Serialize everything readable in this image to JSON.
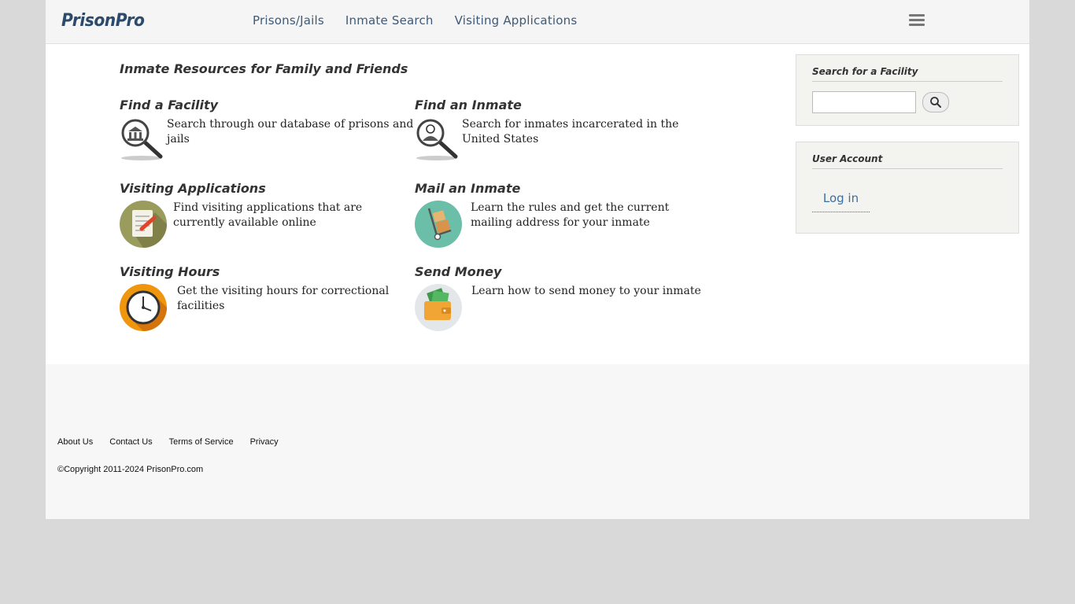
{
  "header": {
    "logo": "PrisonPro",
    "nav": [
      "Prisons/Jails",
      "Inmate Search",
      "Visiting Applications"
    ]
  },
  "main": {
    "title": "Inmate Resources for Family and Friends",
    "resources": [
      {
        "title": "Find a Facility",
        "desc": "Search through our database of prisons and jails",
        "icon": "facility-magnifier-icon"
      },
      {
        "title": "Find an Inmate",
        "desc": "Search for inmates incarcerated in the United States",
        "icon": "inmate-magnifier-icon"
      },
      {
        "title": "Visiting Applications",
        "desc": "Find visiting applications that are currently available online",
        "icon": "application-form-icon"
      },
      {
        "title": "Mail an Inmate",
        "desc": "Learn the rules and get the current mailing address for your inmate",
        "icon": "hand-truck-mail-icon"
      },
      {
        "title": "Visiting Hours",
        "desc": "Get the visiting hours for correctional facilities",
        "icon": "clock-icon"
      },
      {
        "title": "Send Money",
        "desc": "Learn how to send money to your inmate",
        "icon": "wallet-money-icon"
      }
    ]
  },
  "sidebar": {
    "search_title": "Search for a Facility",
    "search_value": "",
    "account_title": "User Account",
    "login_label": "Log in"
  },
  "footer": {
    "links": [
      "About Us",
      "Contact Us",
      "Terms of Service",
      "Privacy"
    ],
    "copyright": "©Copyright 2011-2024 PrisonPro.com"
  },
  "colors": {
    "page_bg": "#d9d9d9",
    "nav_text": "#3d5a78",
    "link": "#3a6ea5"
  }
}
